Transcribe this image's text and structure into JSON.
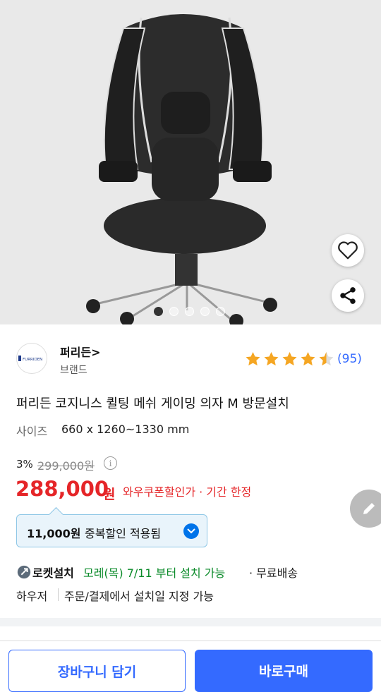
{
  "gallery": {
    "dots": 5,
    "active_dot": 1,
    "wishlist_icon": "heart-icon",
    "share_icon": "share-icon"
  },
  "brand": {
    "name": "퍼리든>",
    "sub": "브랜드",
    "logo_text": "FURRIDEN",
    "rating": 4.5,
    "reviews": "(95)"
  },
  "product": {
    "title": "퍼리든 코지니스 퀼팅 메쉬 게이밍 의자 M 방문설치",
    "size_label": "사이즈",
    "size_value": "660 x 1260~1330 mm",
    "discount": "3%",
    "original_price": "299,000원",
    "price": "288,000",
    "price_unit": "원",
    "coupon_note": "와우쿠폰할인가 · 기간 한정"
  },
  "coupon": {
    "amount": "11,000원",
    "label": "중복할인 적용됨"
  },
  "delivery": {
    "rocket_label": "로켓설치",
    "date": "모레(목) 7/11 부터 설치 가능",
    "free": "· 무료배송",
    "installer": "하우저",
    "install_note": "주문/결제에서 설치일 지정 가능"
  },
  "actions": {
    "cart": "장바구니 담기",
    "buy": "바로구매"
  },
  "colors": {
    "accent": "#346aff",
    "price": "#e52528",
    "rocket_date": "#0a8a29",
    "star": "#f5a623"
  }
}
